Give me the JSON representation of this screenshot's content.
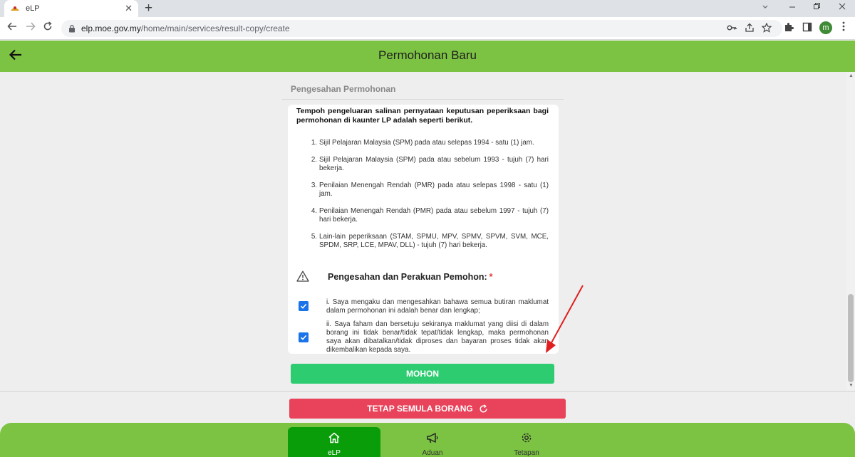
{
  "browser": {
    "tab_title": "eLP",
    "tab_close": "✕",
    "new_tab": "+",
    "url_host": "elp.moe.gov.my",
    "url_path": "/home/main/services/result-copy/create",
    "profile_initial": "m"
  },
  "header": {
    "title": "Permohonan Baru"
  },
  "section": {
    "title": "Pengesahan Permohonan"
  },
  "intro_text": "Tempoh pengeluaran salinan pernyataan keputusan peperiksaan bagi permohonan di kaunter LP adalah seperti berikut.",
  "items": [
    {
      "num": "1.",
      "text": "Sijil Pelajaran Malaysia (SPM) pada atau selepas 1994 - satu (1) jam."
    },
    {
      "num": "2.",
      "text": "Sijil Pelajaran Malaysia (SPM) pada atau sebelum 1993 - tujuh (7) hari bekerja."
    },
    {
      "num": "3.",
      "text": "Penilaian Menengah Rendah (PMR) pada atau selepas 1998 - satu (1) jam."
    },
    {
      "num": "4.",
      "text": "Penilaian Menengah Rendah (PMR) pada atau sebelum 1997 - tujuh (7) hari bekerja."
    },
    {
      "num": "5.",
      "text": "Lain-lain peperiksaan (STAM, SPMU, MPV, SPMV, SPVM, SVM, MCE, SPDM, SRP, LCE, MPAV, DLL) - tujuh (7) hari bekerja."
    }
  ],
  "confirm": {
    "heading": "Pengesahan dan Perakuan Pemohon:",
    "required_mark": "*",
    "declarations": [
      {
        "text": "i. Saya mengaku dan mengesahkan bahawa semua butiran maklumat dalam permohonan ini adalah benar dan lengkap;",
        "checked": true
      },
      {
        "text": "ii. Saya faham dan bersetuju sekiranya maklumat yang diisi di dalam borang ini tidak benar/tidak tepat/tidak lengkap, maka permohonan saya akan dibatalkan/tidak diproses dan bayaran proses tidak akan dikembalikan kepada saya.",
        "checked": true
      }
    ]
  },
  "buttons": {
    "submit": "MOHON",
    "reset": "TETAP SEMULA BORANG"
  },
  "bottom_nav": [
    {
      "label": "eLP",
      "icon": "home-icon",
      "active": true
    },
    {
      "label": "Aduan",
      "icon": "megaphone-icon",
      "active": false
    },
    {
      "label": "Tetapan",
      "icon": "gear-icon",
      "active": false
    }
  ],
  "colors": {
    "app_green": "#7cc343",
    "submit_green": "#2ecc71",
    "reset_red": "#e8435a",
    "active_nav": "#0a9d0a",
    "checkbox_blue": "#1a73e8"
  }
}
